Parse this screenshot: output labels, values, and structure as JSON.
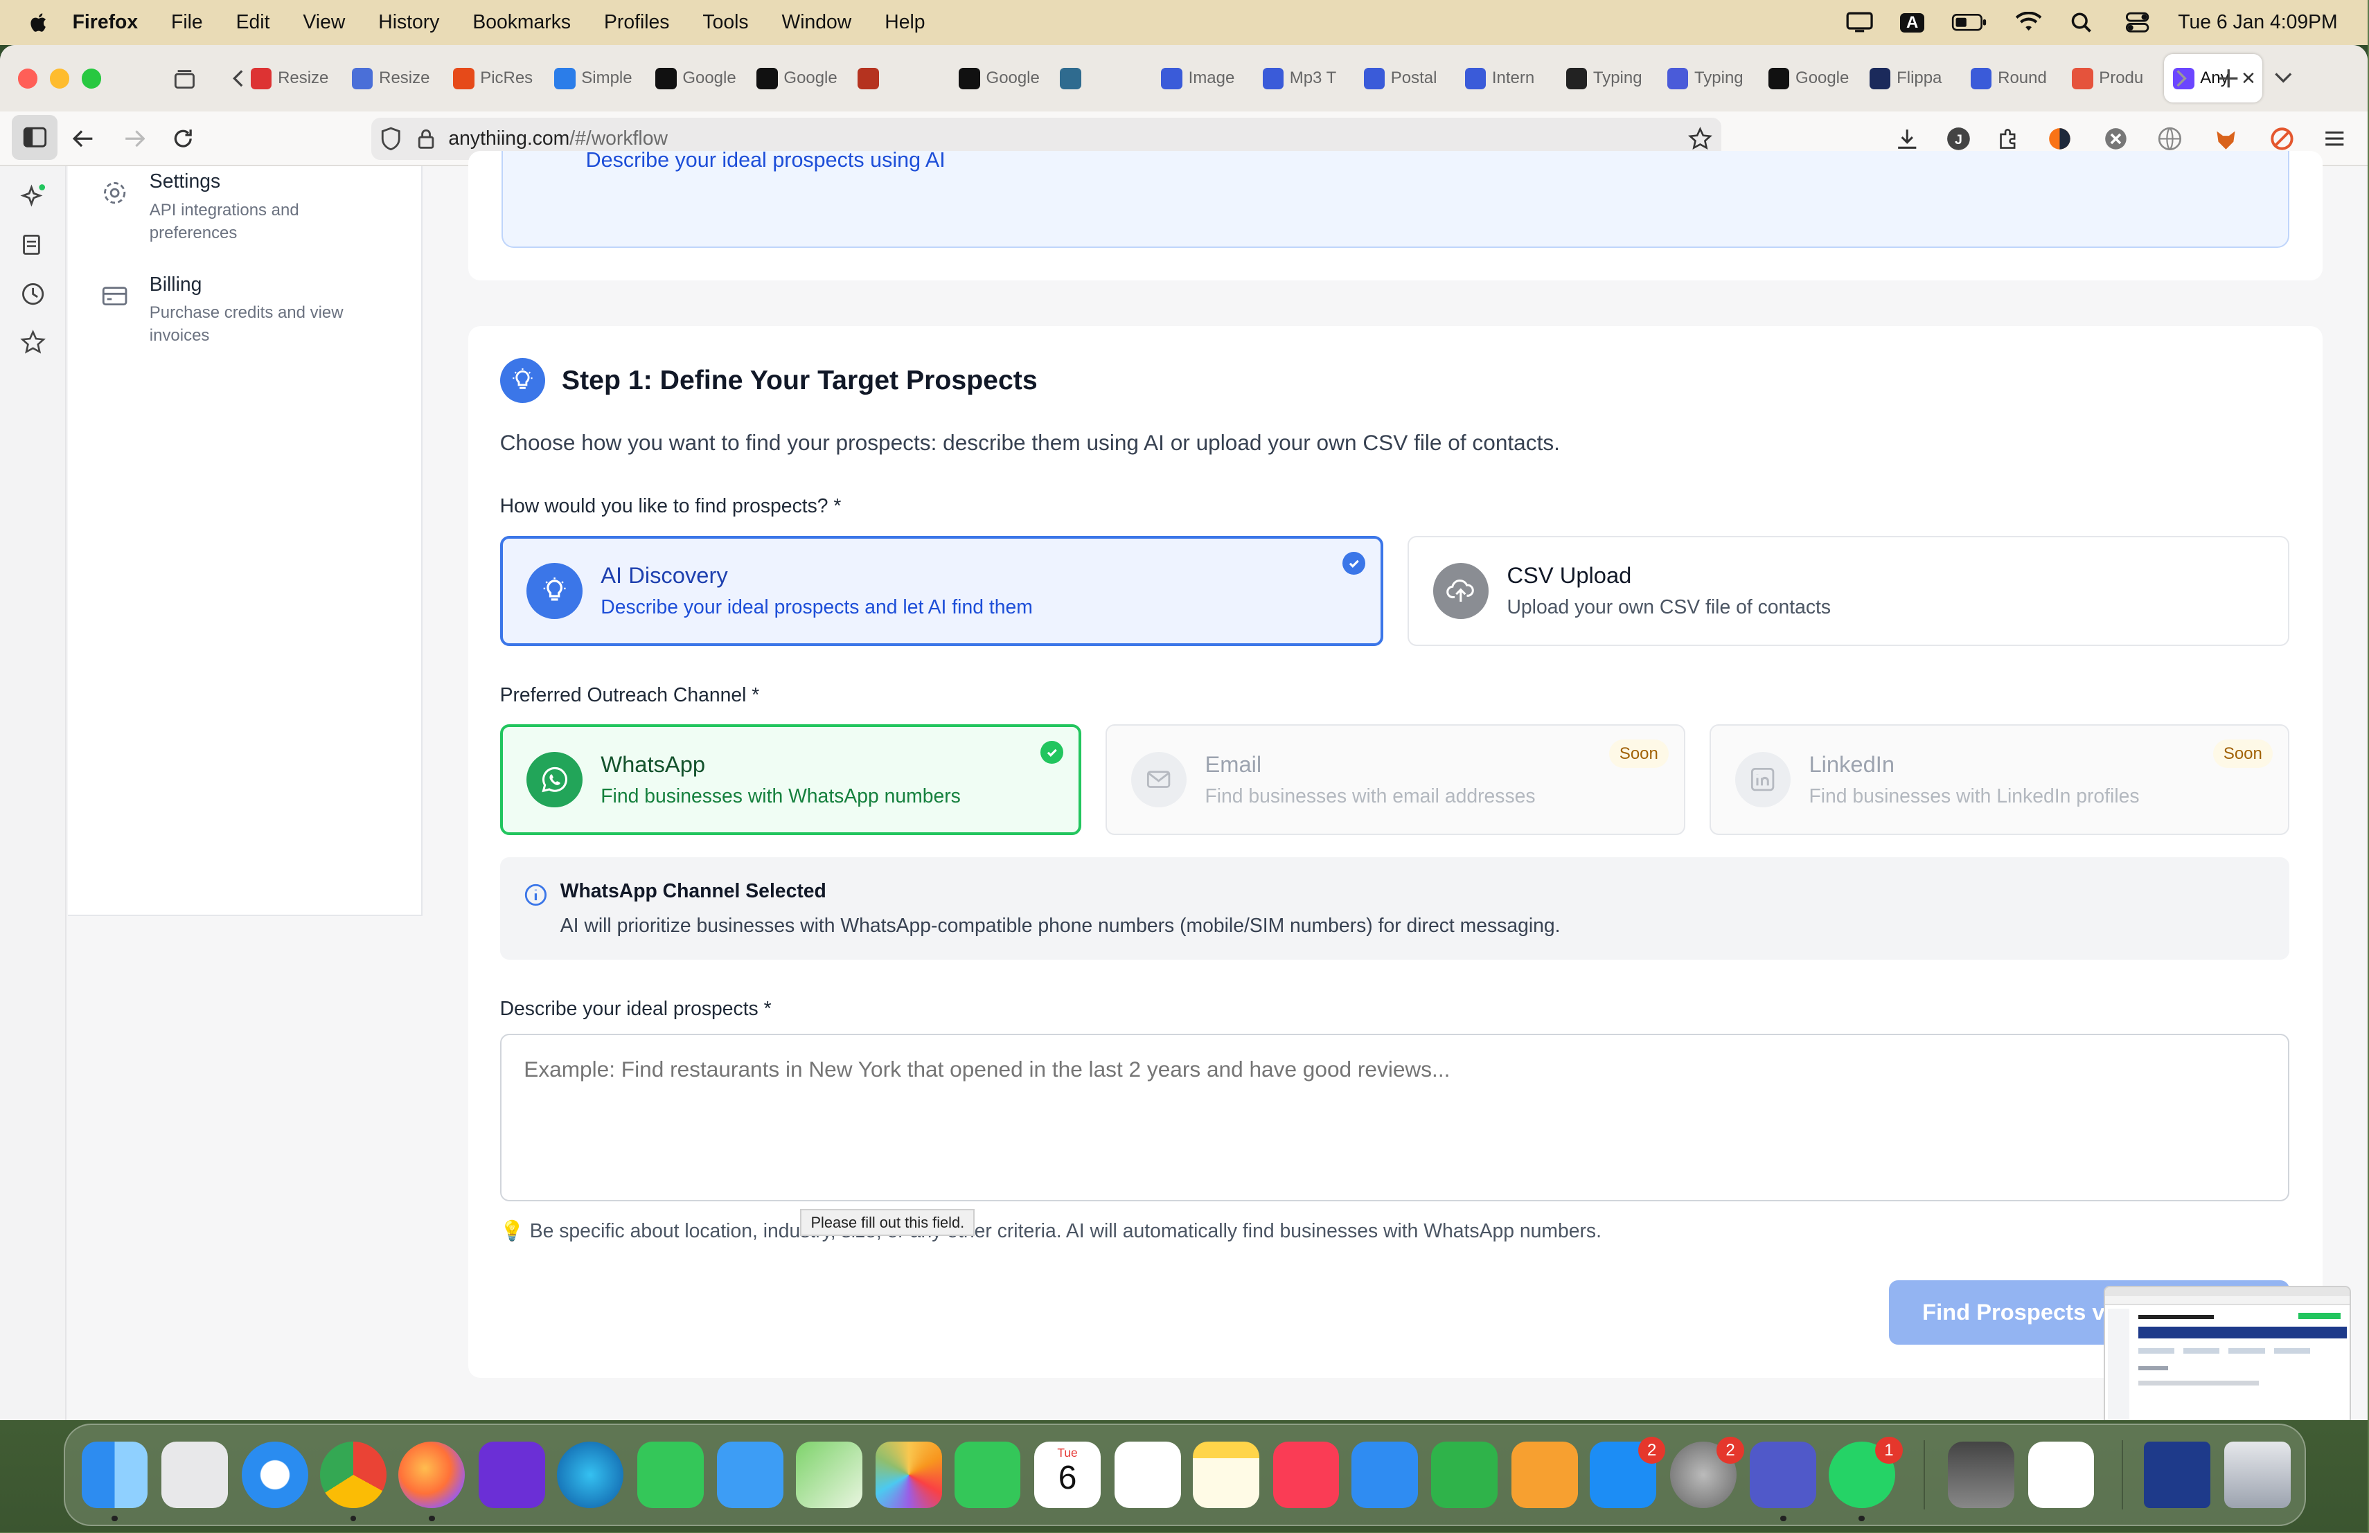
{
  "menubar": {
    "app_name": "Firefox",
    "items": [
      "File",
      "Edit",
      "View",
      "History",
      "Bookmarks",
      "Profiles",
      "Tools",
      "Window",
      "Help"
    ],
    "clock": "Tue 6 Jan  4:09PM",
    "input_indicator": "A"
  },
  "browser": {
    "tabs": [
      {
        "label": "Resize",
        "color": "#d33"
      },
      {
        "label": "Resize",
        "color": "#4a6fd8"
      },
      {
        "label": "PicRes",
        "color": "#e64a19"
      },
      {
        "label": "Simple",
        "color": "#2b7de9"
      },
      {
        "label": "Google",
        "color": "#111"
      },
      {
        "label": "Google",
        "color": "#111"
      },
      {
        "label": "",
        "color": "#b5331f"
      },
      {
        "label": "Google",
        "color": "#111"
      },
      {
        "label": "",
        "color": "#2f6b8f"
      },
      {
        "label": "Image",
        "color": "#3a5bd9"
      },
      {
        "label": "Mp3 T",
        "color": "#3a5bd9"
      },
      {
        "label": "Postal",
        "color": "#3a5bd9"
      },
      {
        "label": "Intern",
        "color": "#3a5bd9"
      },
      {
        "label": "Typing",
        "color": "#222"
      },
      {
        "label": "Typing",
        "color": "#4a5bd9"
      },
      {
        "label": "Google",
        "color": "#111"
      },
      {
        "label": "Flippa",
        "color": "#1b2a5b"
      },
      {
        "label": "Round",
        "color": "#3a5bd9"
      },
      {
        "label": "Produ",
        "color": "#e5533c"
      },
      {
        "label": "Any",
        "color": "#6b46ff"
      }
    ],
    "url_host": "anythiing.com",
    "url_path": "/#/workflow"
  },
  "sidebar": {
    "items": [
      {
        "title": "Settings",
        "desc": "API integrations and preferences"
      },
      {
        "title": "Billing",
        "desc": "Purchase credits and view invoices"
      }
    ]
  },
  "top_card_text": "Describe your ideal prospects using AI",
  "step": {
    "title": "Step 1: Define Your Target Prospects",
    "intro": "Choose how you want to find your prospects: describe them using AI or upload your own CSV file of contacts.",
    "method_label": "How would you like to find prospects? *",
    "methods": [
      {
        "title": "AI Discovery",
        "desc": "Describe your ideal prospects and let AI find them"
      },
      {
        "title": "CSV Upload",
        "desc": "Upload your own CSV file of contacts"
      }
    ],
    "channel_label": "Preferred Outreach Channel *",
    "channels": [
      {
        "title": "WhatsApp",
        "desc": "Find businesses with WhatsApp numbers"
      },
      {
        "title": "Email",
        "desc": "Find businesses with email addresses",
        "badge": "Soon"
      },
      {
        "title": "LinkedIn",
        "desc": "Find businesses with LinkedIn profiles",
        "badge": "Soon"
      }
    ],
    "info_title": "WhatsApp Channel Selected",
    "info_text": "AI will prioritize businesses with WhatsApp-compatible phone numbers (mobile/SIM numbers) for direct messaging.",
    "describe_label": "Describe your ideal prospects *",
    "describe_placeholder": "Example: Find restaurants in New York that opened in the last 2 years and have good reviews...",
    "validation_tooltip": "Please fill out this field.",
    "hint": "Be specific about location, industry, size, or any other criteria. AI will automatically find businesses with WhatsApp numbers.",
    "submit_label": "Find Prospects via WhatsApp"
  },
  "dock": {
    "calendar_month": "Tue",
    "calendar_day": "6",
    "badges": {
      "app_store": "2",
      "system_settings": "2",
      "whatsapp": "1"
    }
  }
}
